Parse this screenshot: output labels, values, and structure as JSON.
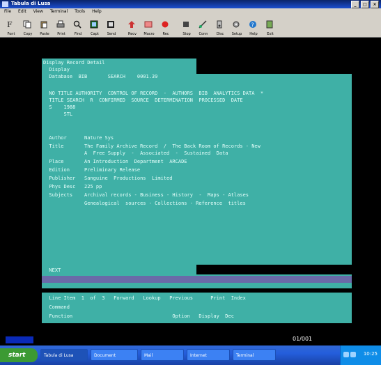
{
  "window": {
    "title": "Tabula di Lusa",
    "minimize_label": "_",
    "maximize_label": "□",
    "close_label": "×"
  },
  "menubar": {
    "items": [
      "File",
      "Edit",
      "View",
      "Terminal",
      "Tools",
      "Help"
    ]
  },
  "toolbar": {
    "buttons": [
      {
        "icon": "font-icon",
        "caption": "Font"
      },
      {
        "icon": "copy-icon",
        "caption": "Copy"
      },
      {
        "icon": "paste-icon",
        "caption": "Paste"
      },
      {
        "icon": "print-icon",
        "caption": "Print"
      },
      {
        "icon": "find-icon",
        "caption": "Find"
      },
      {
        "icon": "capture-icon",
        "caption": "Capt"
      },
      {
        "icon": "send-icon",
        "caption": "Send"
      },
      {
        "icon": "receive-icon",
        "caption": "Recv"
      },
      {
        "icon": "macro-icon",
        "caption": "Macro"
      },
      {
        "icon": "record-icon",
        "caption": "Rec"
      },
      {
        "icon": "stop-icon",
        "caption": "Stop"
      },
      {
        "icon": "connect-icon",
        "caption": "Conn"
      },
      {
        "icon": "disconnect-icon",
        "caption": "Disc"
      },
      {
        "icon": "settings-icon",
        "caption": "Setup"
      },
      {
        "icon": "help-icon",
        "caption": "Help"
      },
      {
        "icon": "exit-icon",
        "caption": "Exit"
      }
    ]
  },
  "terminal": {
    "lines": [
      "Display Record Detail",
      "  Display",
      "  Database  BIB       SEARCH    0001.39",
      "",
      "  NO TITLE AUTHORITY  CONTROL OF RECORD  -  AUTHORS  BIB  ANALYTICS DATA  *",
      "  TITLE SEARCH  R  CONFIRMED  SOURCE  DETERMINATION  PROCESSED  DATE",
      "  S    1988",
      "       STL",
      "",
      "  Author      Nature Sys",
      "  Title       The Family Archive Record  /  The Back Room of Records - New",
      "              A  Free Supply  -  Associated  -  Sustained  Data",
      "  Place       An Introduction  Department  ARCADE",
      "  Edition     Preliminary Release",
      "  Publisher   Sanguine  Productions  Limited",
      "  Phys Desc   225 pp",
      "  Subjects    Archival records - Business - History  -  Maps - Atlases",
      "              Genealogical  sources - Collections - Reference  titles",
      "",
      "  NEXT"
    ],
    "footer_lines": [
      "  Line Item  1  of  3   Forward   Lookup   Previous      Print  Index",
      "  Command",
      "  Function                                  Option   Display  Dec"
    ]
  },
  "status": {
    "cursor_position": "01/001"
  },
  "taskbar": {
    "start_label": "start",
    "tasks": [
      "Tabula di Lusa",
      "Document",
      "Mail",
      "Internet",
      "Terminal"
    ],
    "clock": "10:25"
  },
  "colors": {
    "panel": "#3fb0a6",
    "terminal_bg": "#000000",
    "separator": "#6a6aa8",
    "titlebar": "#0a246a"
  }
}
